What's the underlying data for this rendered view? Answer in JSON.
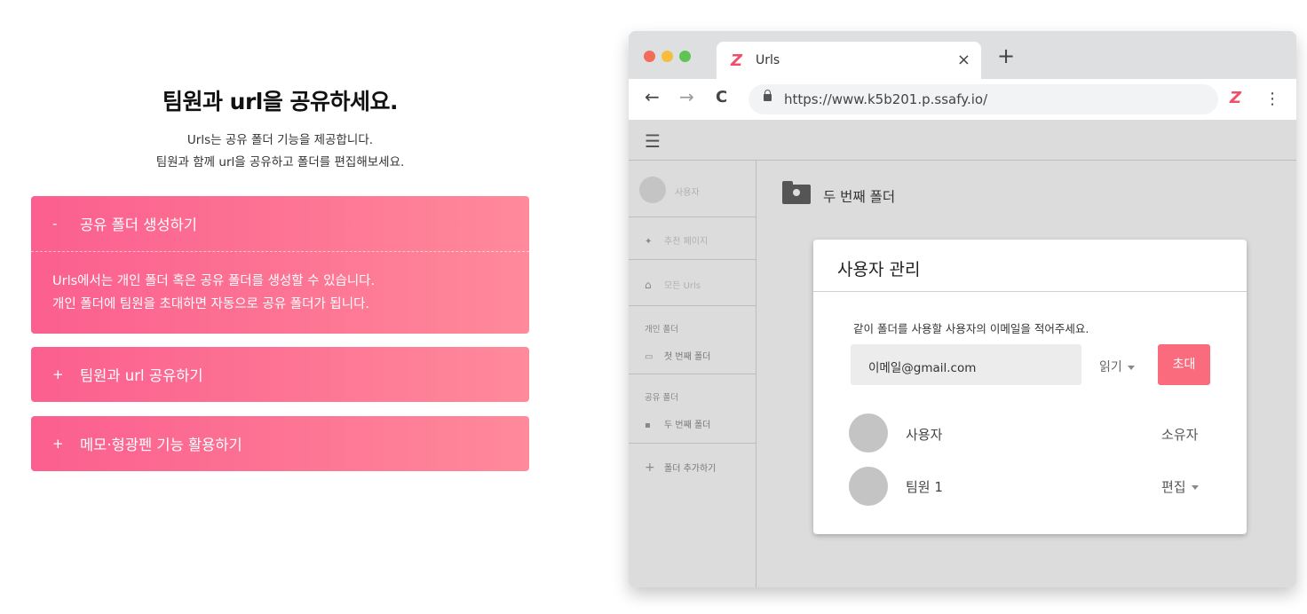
{
  "hero": {
    "headline": "팀원과 url을 공유하세요.",
    "sub_line1": "Urls는 공유 폴더 기능을 제공합니다.",
    "sub_line2": "팀원과 함께 url을 공유하고 폴더를 편집해보세요."
  },
  "accordion": [
    {
      "sign": "-",
      "title": "공유 폴더 생성하기",
      "expanded": true,
      "body_line1": "Urls에서는 개인 폴더 혹은 공유 폴더를 생성할 수 있습니다.",
      "body_line2": "개인 폴더에 팀원을 초대하면 자동으로 공유 폴더가 됩니다."
    },
    {
      "sign": "+",
      "title": "팀원과 url 공유하기",
      "expanded": false
    },
    {
      "sign": "+",
      "title": "메모·형광펜 기능 활용하기",
      "expanded": false
    }
  ],
  "browser": {
    "tab_title": "Urls",
    "tab_close": "×",
    "new_tab": "+",
    "url": "https://www.k5b201.p.ssafy.io/",
    "back": "←",
    "forward": "→",
    "reload": "C",
    "menu": "⋮",
    "logo_glyph": "Z"
  },
  "sidebar": {
    "user": "사용자",
    "recommended": "추천 페이지",
    "all_urls": "모든 Urls",
    "personal_header": "개인 폴더",
    "personal_folder": "첫 번째 폴더",
    "shared_header": "공유 폴더",
    "shared_folder": "두 번째 폴더",
    "add_folder": "폴더 추가하기"
  },
  "content": {
    "folder_title": "두 번째 폴더"
  },
  "dialog": {
    "title": "사용자 관리",
    "description": "같이 폴더를 사용할 사용자의 이메일을 적어주세요.",
    "email_value": "이메일@gmail.com",
    "permission": "읽기",
    "invite_label": "초대",
    "members": [
      {
        "name": "사용자",
        "role": "소유자",
        "has_dropdown": false
      },
      {
        "name": "팀원 1",
        "role": "편집",
        "has_dropdown": true
      }
    ]
  },
  "colors": {
    "accordion_start": "#fb5f8f",
    "accordion_end": "#ff8a9b",
    "invite_button": "#fa6b7d",
    "logo": "#f04e6a"
  }
}
